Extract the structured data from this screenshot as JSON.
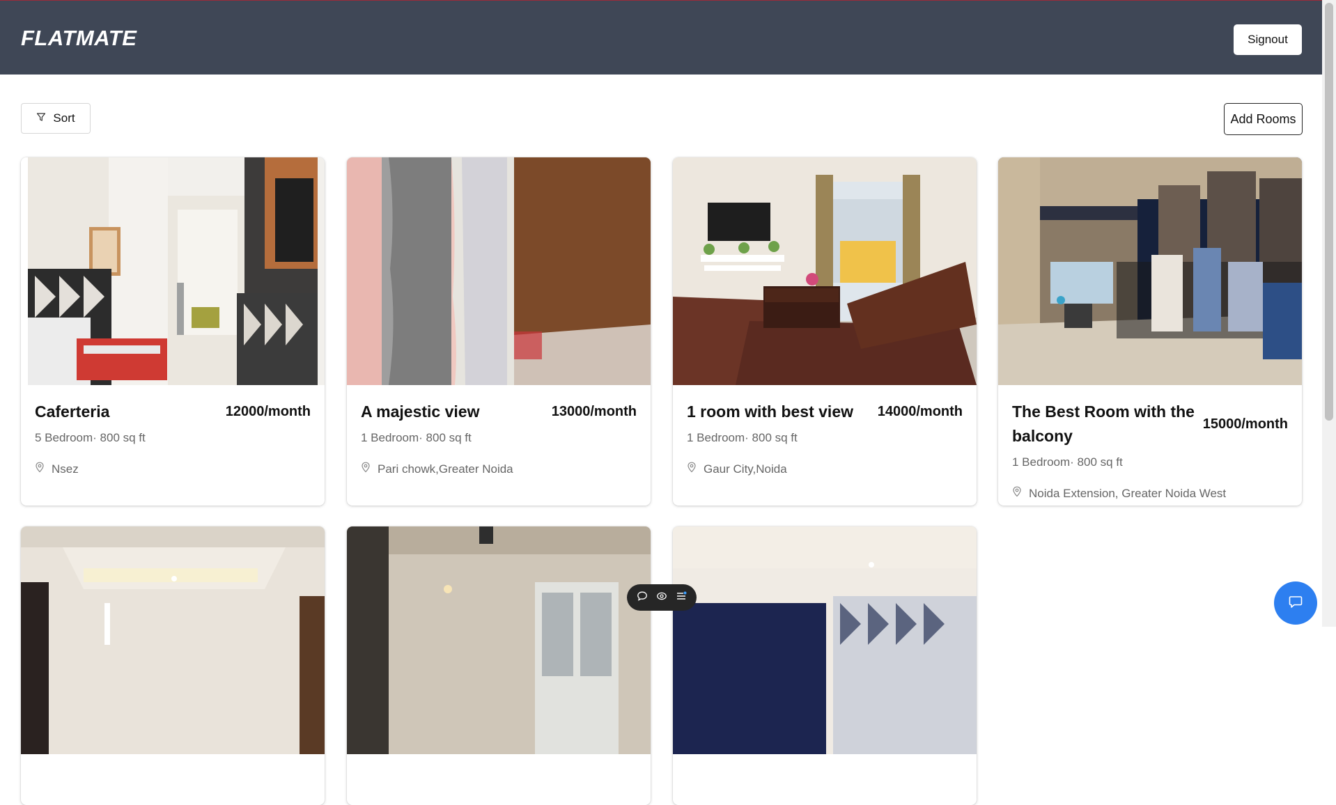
{
  "header": {
    "brand": "FLATMATE",
    "signout_label": "Signout"
  },
  "controls": {
    "sort_label": "Sort",
    "add_rooms_label": "Add Rooms"
  },
  "listings": [
    {
      "title": "Caferteria",
      "price": "12000/month",
      "details": "5 Bedroom· 800 sq ft",
      "location": "Nsez"
    },
    {
      "title": "A majestic view",
      "price": "13000/month",
      "details": "1 Bedroom· 800 sq ft",
      "location": "Pari chowk,Greater Noida"
    },
    {
      "title": "1 room with best view",
      "price": "14000/month",
      "details": "1 Bedroom· 800 sq ft",
      "location": "Gaur City,Noida"
    },
    {
      "title": "The Best Room with the balcony",
      "price": "15000/month",
      "details": "1 Bedroom· 800 sq ft",
      "location": "Noida Extension, Greater Noida West"
    }
  ],
  "colors": {
    "header_bg": "#3f4756",
    "accent": "#2d7ff0",
    "muted_text": "#666666"
  },
  "icons": [
    "filter-icon",
    "location-pin-icon",
    "comment-icon",
    "eye-icon",
    "menu-icon",
    "chat-icon"
  ]
}
